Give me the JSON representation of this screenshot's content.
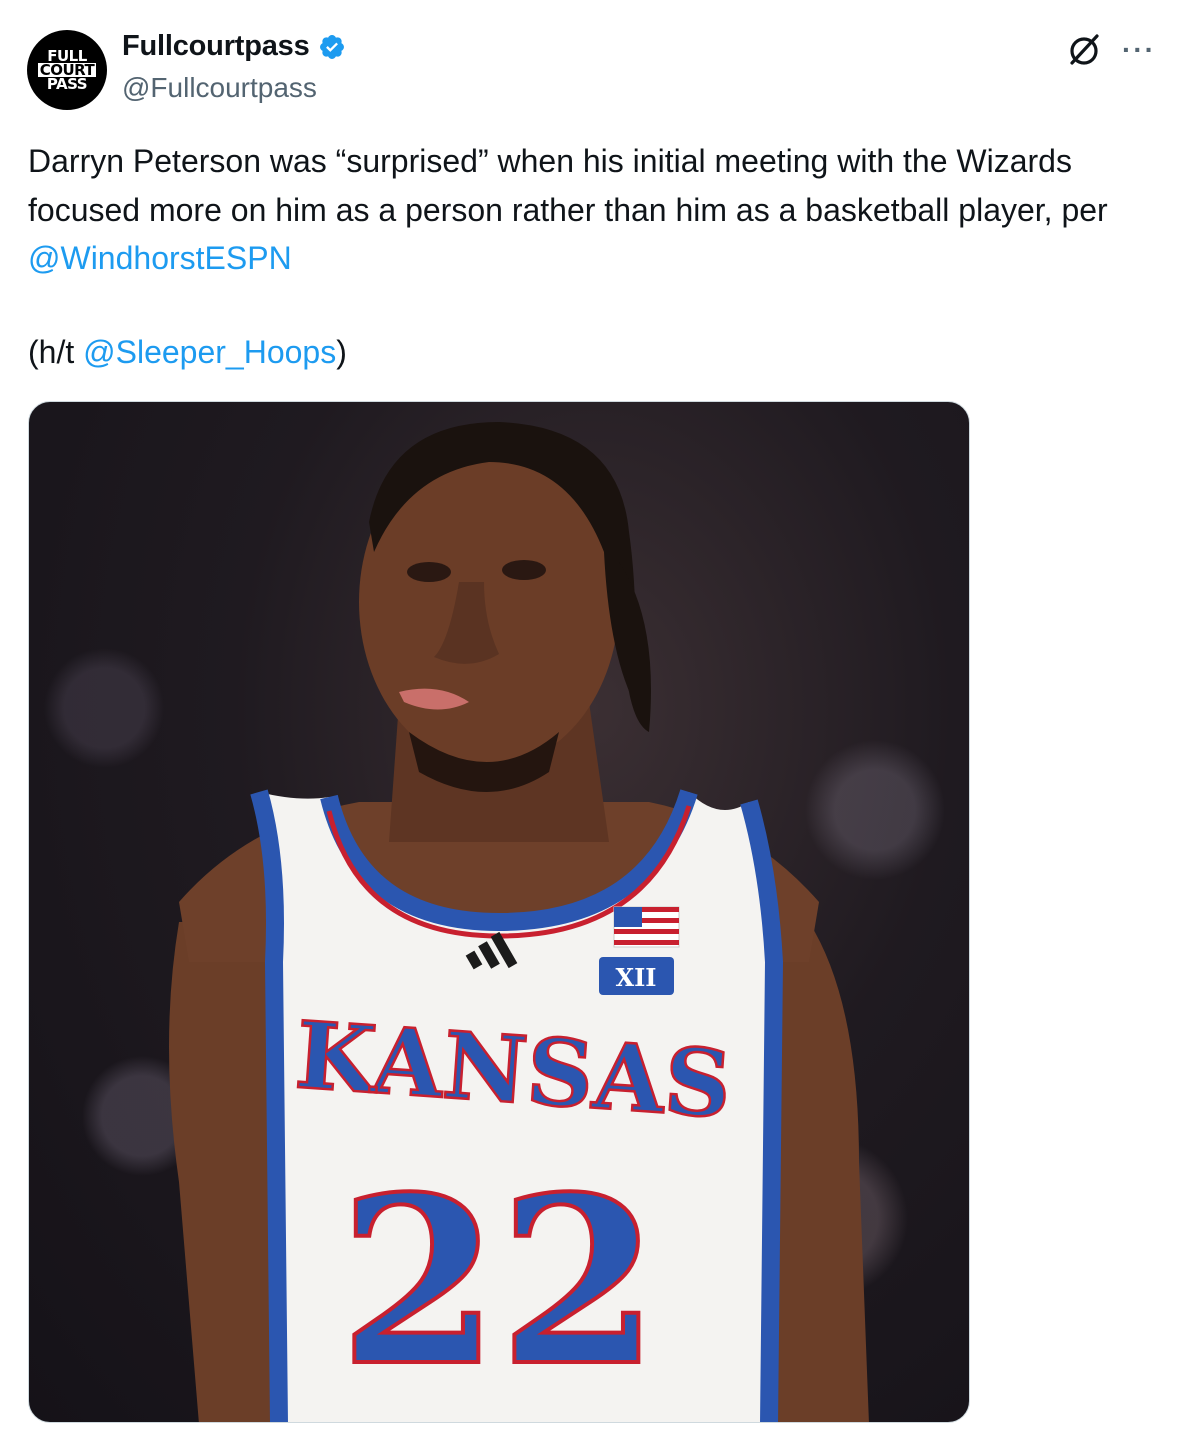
{
  "author": {
    "display_name": "Fullcourtpass",
    "handle": "@Fullcourtpass",
    "verified": true,
    "avatar_logo_lines": [
      "FULL",
      "COURT",
      "PASS"
    ]
  },
  "icons": {
    "grok": "grok-icon",
    "more": "more-icon",
    "verified": "verified-badge-icon"
  },
  "tweet": {
    "text_part1": "Darryn Peterson was “surprised” when his initial meeting with the Wizards focused more on him as a person rather than him as a basketball player, per ",
    "mention1": "@WindhorstESPN",
    "ht_prefix": "(h/t ",
    "mention2": "@Sleeper_Hoops",
    "ht_suffix": ")"
  },
  "media": {
    "jersey_school": "KANSAS",
    "jersey_number": "22",
    "conference_mark": "XII"
  },
  "more_label": "···",
  "colors": {
    "link": "#1d9bf0",
    "secondary_text": "#536471",
    "jersey_blue": "#2b56b0",
    "jersey_red": "#c8202f"
  }
}
